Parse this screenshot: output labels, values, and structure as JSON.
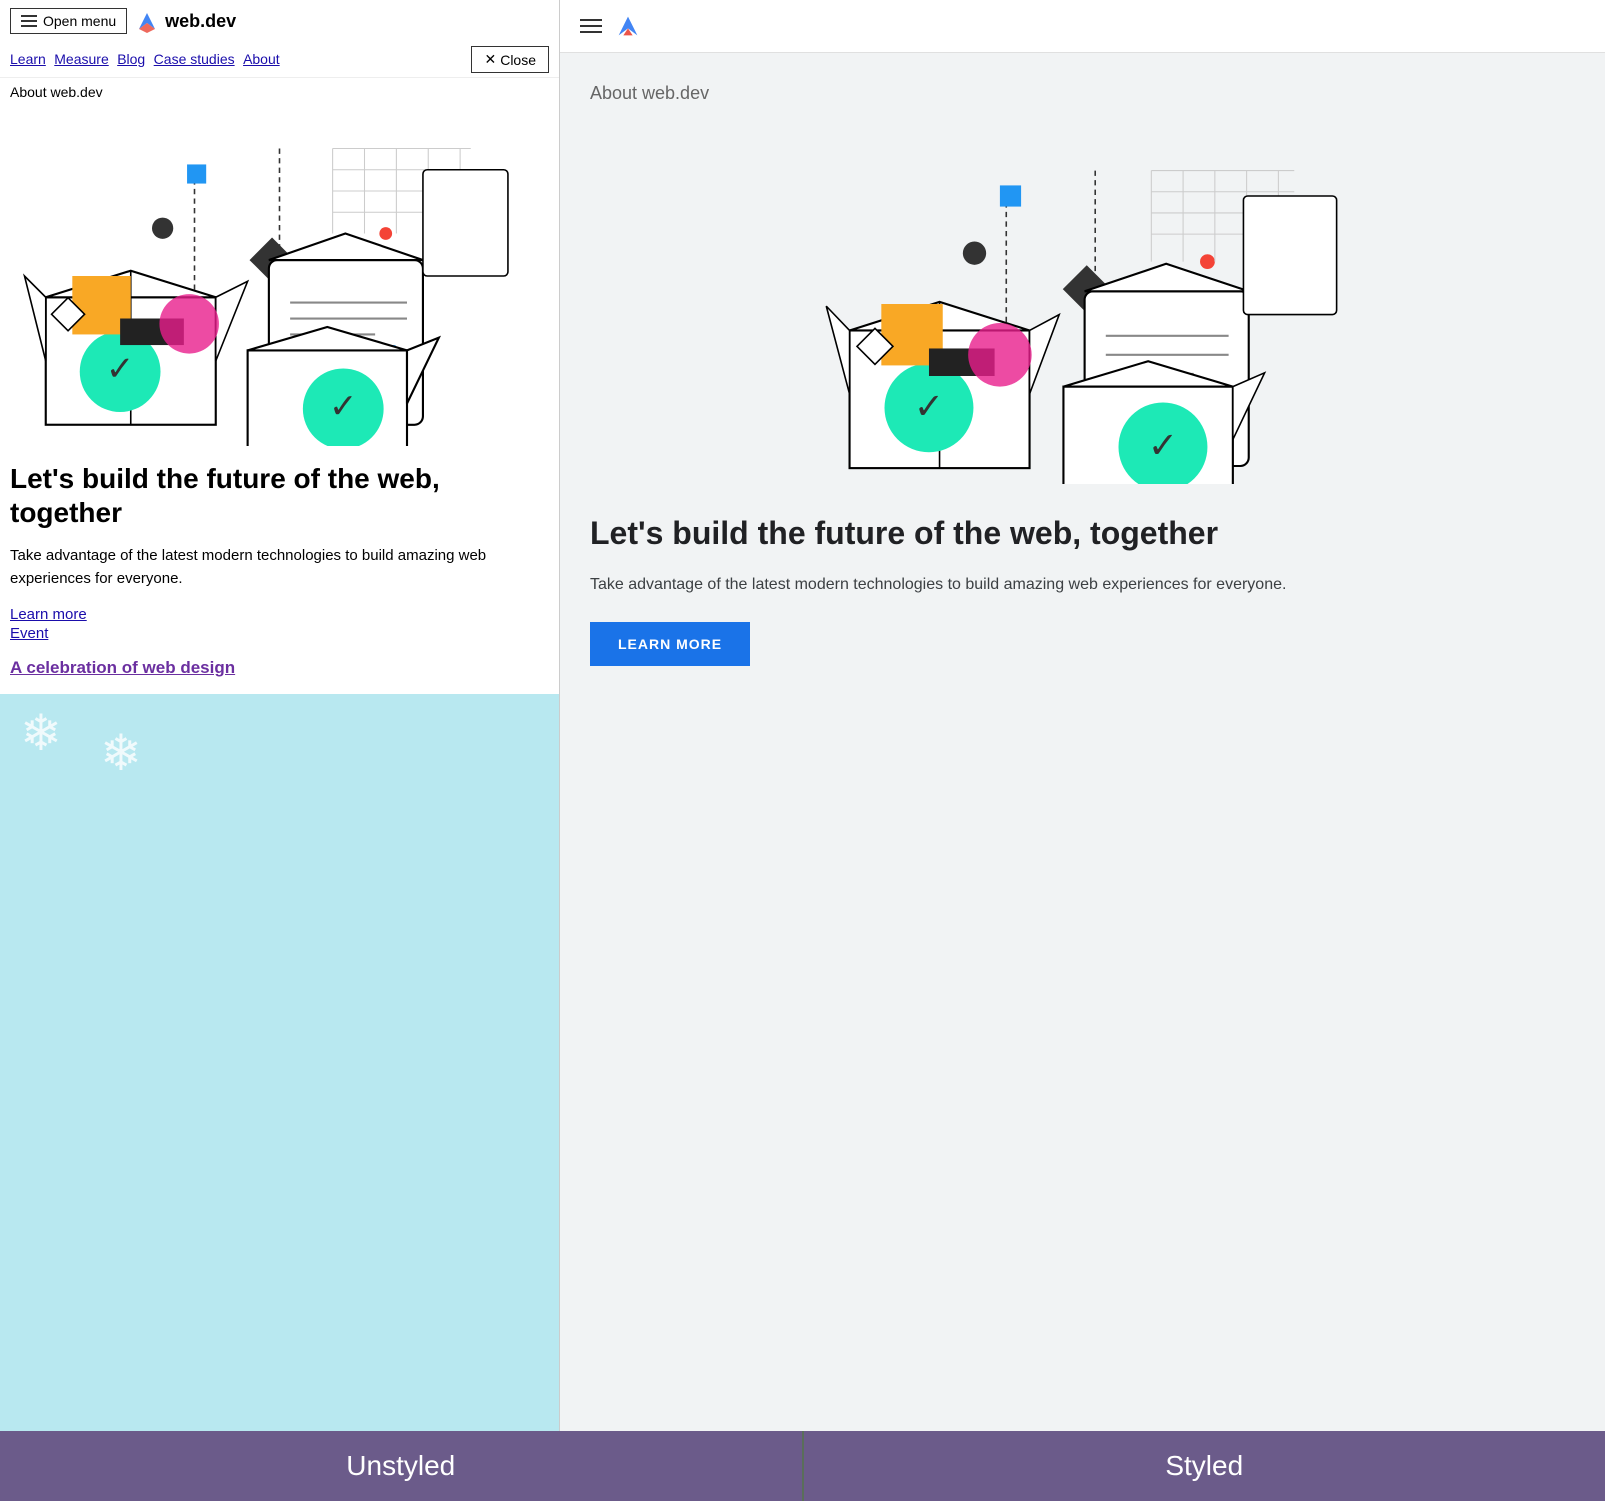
{
  "left": {
    "header": {
      "open_menu": "Open menu",
      "logo_text": "web.dev"
    },
    "nav": {
      "links": [
        "Learn",
        "Measure",
        "Blog",
        "Case studies",
        "About"
      ],
      "close_label": "Close"
    },
    "about_label": "About web.dev",
    "heading": "Let's build the future of the web, together",
    "subtext": "Take advantage of the latest modern technologies to build amazing web experiences for everyone.",
    "link_learn_more": "Learn more",
    "link_event": "Event",
    "celebration_link": "A celebration of web design"
  },
  "right": {
    "about_label": "About web.dev",
    "heading": "Let's build the future of the web, together",
    "subtext": "Take advantage of the latest modern technologies to build amazing web experiences for everyone.",
    "learn_more_btn": "LEARN MORE"
  },
  "footer": {
    "left_label": "Unstyled",
    "right_label": "Styled"
  }
}
